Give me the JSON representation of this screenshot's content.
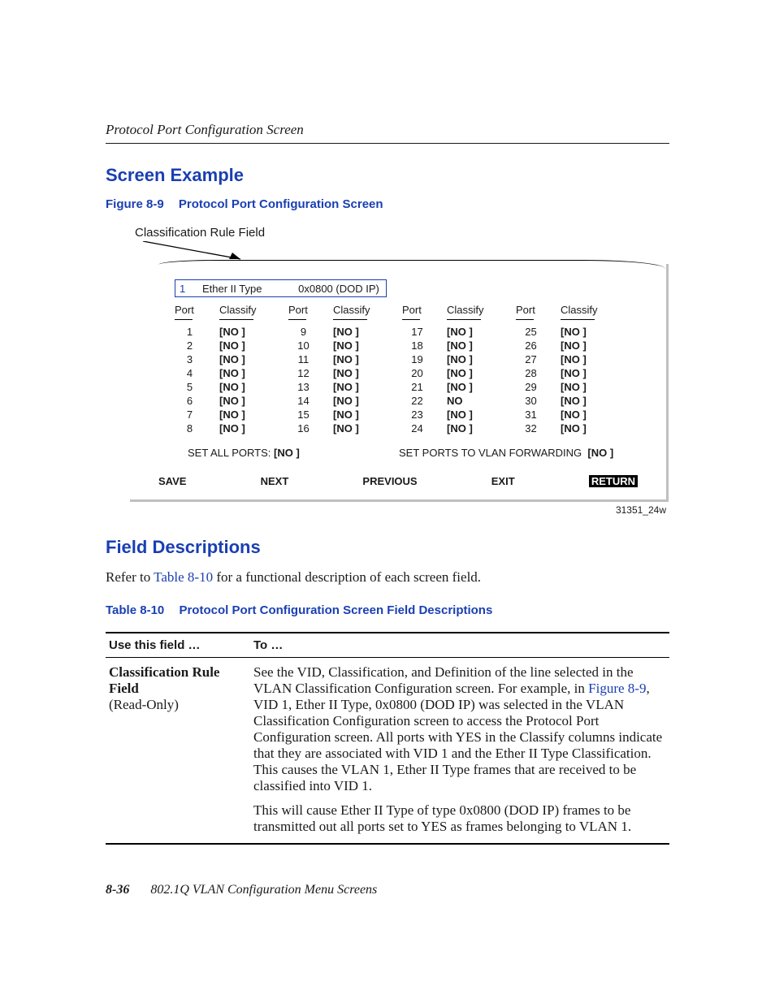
{
  "header": {
    "title": "Protocol Port Configuration Screen"
  },
  "section1": {
    "heading": "Screen Example"
  },
  "figure": {
    "num": "Figure 8-9",
    "title": "Protocol Port Configuration Screen",
    "annotation": "Classification Rule Field",
    "classification_box": {
      "id": "1",
      "type": "Ether II Type",
      "def": "0x0800  (DOD IP)"
    },
    "col_headers": {
      "port": "Port",
      "classify": "Classify"
    },
    "groups": [
      {
        "rows": [
          {
            "port": "1",
            "classify": "[NO ]"
          },
          {
            "port": "2",
            "classify": "[NO ]"
          },
          {
            "port": "3",
            "classify": "[NO ]"
          },
          {
            "port": "4",
            "classify": "[NO ]"
          },
          {
            "port": "5",
            "classify": "[NO ]"
          },
          {
            "port": "6",
            "classify": "[NO ]"
          },
          {
            "port": "7",
            "classify": "[NO ]"
          },
          {
            "port": "8",
            "classify": "[NO ]"
          }
        ]
      },
      {
        "rows": [
          {
            "port": "9",
            "classify": "[NO ]"
          },
          {
            "port": "10",
            "classify": "[NO ]"
          },
          {
            "port": "11",
            "classify": "[NO ]"
          },
          {
            "port": "12",
            "classify": "[NO ]"
          },
          {
            "port": "13",
            "classify": "[NO ]"
          },
          {
            "port": "14",
            "classify": "[NO ]"
          },
          {
            "port": "15",
            "classify": "[NO ]"
          },
          {
            "port": "16",
            "classify": "[NO ]"
          }
        ]
      },
      {
        "rows": [
          {
            "port": "17",
            "classify": "[NO ]"
          },
          {
            "port": "18",
            "classify": "[NO ]"
          },
          {
            "port": "19",
            "classify": "[NO ]"
          },
          {
            "port": "20",
            "classify": "[NO ]"
          },
          {
            "port": "21",
            "classify": "[NO ]"
          },
          {
            "port": "22",
            "classify": "NO"
          },
          {
            "port": "23",
            "classify": "[NO ]"
          },
          {
            "port": "24",
            "classify": "[NO ]"
          }
        ]
      },
      {
        "rows": [
          {
            "port": "25",
            "classify": "[NO ]"
          },
          {
            "port": "26",
            "classify": "[NO ]"
          },
          {
            "port": "27",
            "classify": "[NO ]"
          },
          {
            "port": "28",
            "classify": "[NO ]"
          },
          {
            "port": "29",
            "classify": "[NO ]"
          },
          {
            "port": "30",
            "classify": "[NO ]"
          },
          {
            "port": "31",
            "classify": "[NO ]"
          },
          {
            "port": "32",
            "classify": "[NO ]"
          }
        ]
      }
    ],
    "set_all_label": "SET ALL PORTS:",
    "set_all_value": "[NO ]",
    "set_vlan_label": "SET PORTS TO VLAN FORWARDING",
    "set_vlan_value": "[NO ]",
    "nav": {
      "save": "SAVE",
      "next": "NEXT",
      "previous": "PREVIOUS",
      "exit": "EXIT",
      "return": "RETURN"
    },
    "image_id": "31351_24w"
  },
  "section2": {
    "heading": "Field Descriptions",
    "lead_pre": "Refer to ",
    "lead_link": "Table 8-10",
    "lead_post": " for a functional description of each screen field."
  },
  "table": {
    "num": "Table 8-10",
    "title": "Protocol Port Configuration Screen Field Descriptions",
    "header_field": "Use this field …",
    "header_to": "To …",
    "rows": [
      {
        "field_line1": "Classification Rule Field",
        "field_line2": "(Read-Only)",
        "desc_p1_pre": "See the VID, Classification, and Definition of the line selected in the VLAN Classification Configuration screen. For example, in ",
        "desc_p1_link": "Figure 8-9",
        "desc_p1_post": ", VID 1, Ether II Type, 0x0800 (DOD IP) was selected in the VLAN Classification Configuration screen to access the Protocol Port Configuration screen. All ports with YES in the Classify columns indicate that they are associated with VID 1 and the Ether II Type Classification. This causes the VLAN 1, Ether II Type frames that are received to be classified into VID 1.",
        "desc_p2": "This will cause Ether II Type of type 0x0800 (DOD IP) frames to be transmitted out all ports set to YES as frames belonging to VLAN 1."
      }
    ]
  },
  "footer": {
    "page": "8-36",
    "title": "802.1Q VLAN Configuration Menu Screens"
  }
}
